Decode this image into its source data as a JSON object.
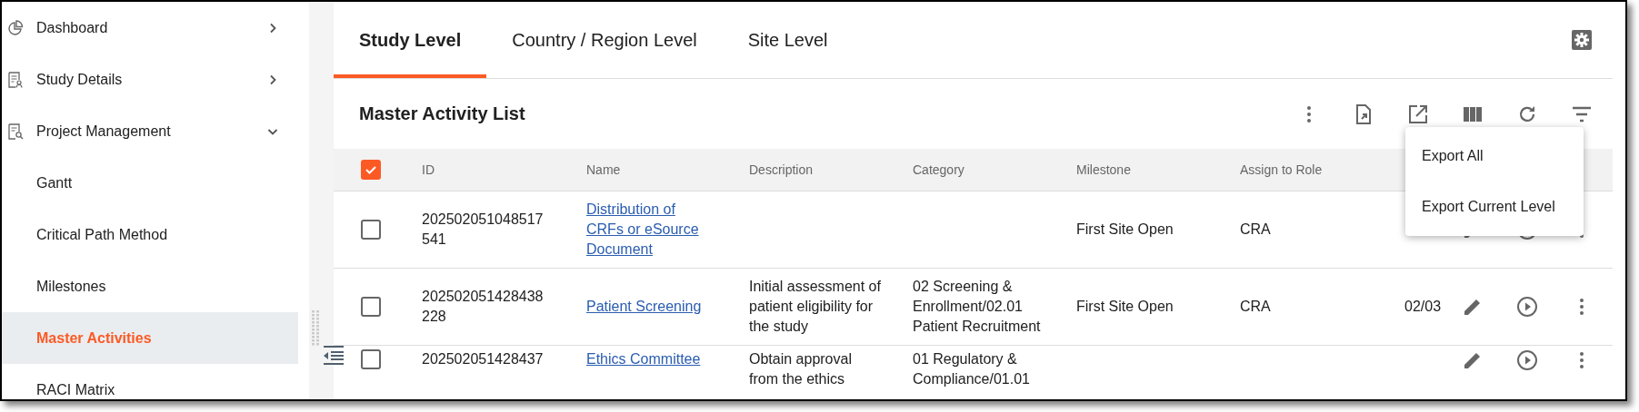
{
  "sidebar": {
    "items": [
      {
        "label": "Dashboard",
        "expanded": false,
        "selected": false
      },
      {
        "label": "Study Details",
        "expanded": false,
        "selected": false
      },
      {
        "label": "Project Management",
        "expanded": true,
        "selected": false,
        "children": [
          {
            "label": "Gantt",
            "selected": false
          },
          {
            "label": "Critical Path Method",
            "selected": false
          },
          {
            "label": "Milestones",
            "selected": false
          },
          {
            "label": "Master Activities",
            "selected": true
          },
          {
            "label": "RACI Matrix",
            "selected": false
          }
        ]
      }
    ]
  },
  "tabs": [
    {
      "label": "Study Level",
      "selected": true
    },
    {
      "label": "Country / Region Level",
      "selected": false
    },
    {
      "label": "Site Level",
      "selected": false
    }
  ],
  "toolbar": {
    "title": "Master Activity List"
  },
  "export_menu": [
    "Export All",
    "Export Current Level"
  ],
  "table": {
    "select_all": {
      "checked": true
    },
    "columns": [
      "ID",
      "Name",
      "Description",
      "Category",
      "Milestone",
      "Assign to Role"
    ],
    "rows": [
      {
        "checked": false,
        "id": "202502051048517541",
        "name": "Distribution of CRFs or eSource Document",
        "milestone": "First Site Open",
        "role": "CRA"
      },
      {
        "checked": false,
        "id": "202502051428438228",
        "name": "Patient Screening",
        "description": "Initial assessment of patient eligibility for the study",
        "category": "02 Screening & Enrollment/02.01 Patient Recruitment",
        "milestone": "First Site Open",
        "role": "CRA",
        "column_8": "02/03"
      },
      {
        "checked": false,
        "id": "202502051428437",
        "name": "Ethics Committee",
        "description": "Obtain approval from the ethics",
        "category": "01 Regulatory & Compliance/01.01"
      }
    ]
  }
}
